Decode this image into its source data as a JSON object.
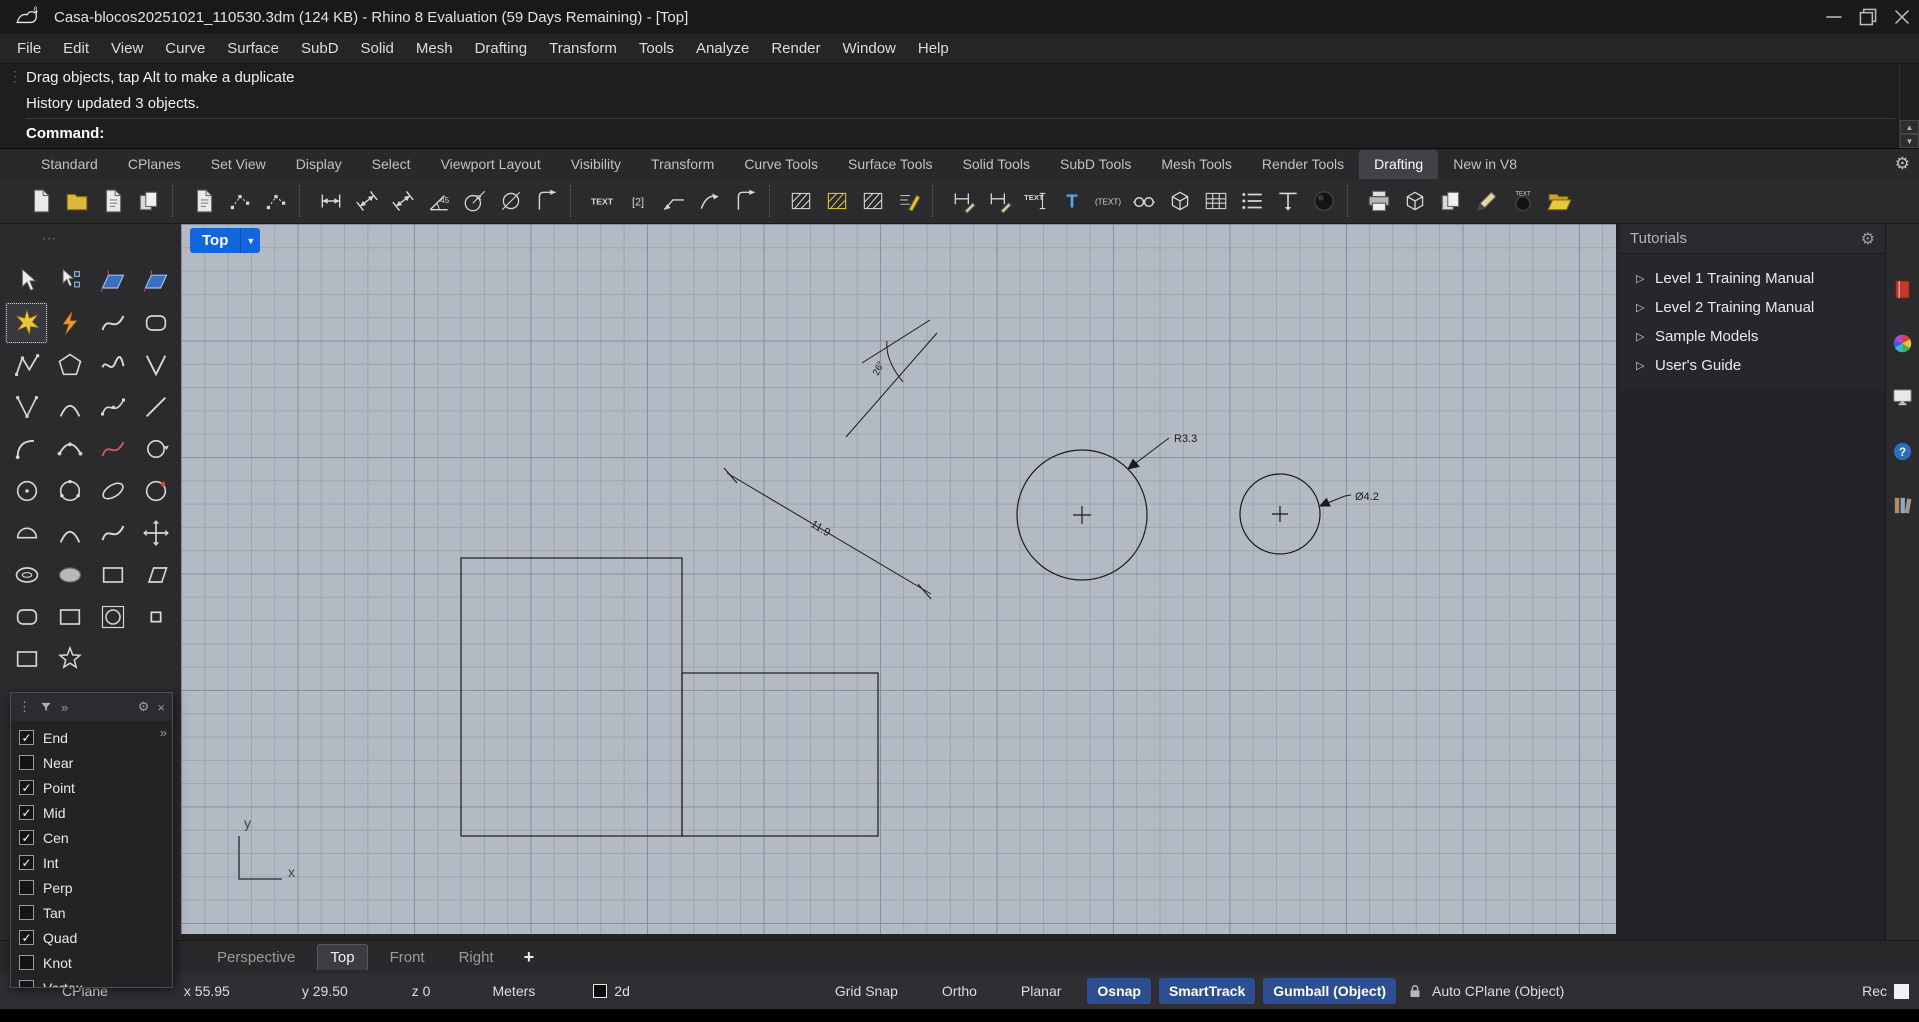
{
  "icons": {
    "gear_glyph": "⚙",
    "dropdown_glyph": "▼",
    "expander_glyph": "▷",
    "chevrons_glyph": "»",
    "close_glyph": "×",
    "dots_glyph": "⋮",
    "dots_h_glyph": "⋯",
    "plus_glyph": "+",
    "spin_up_glyph": "▲",
    "spin_down_glyph": "▼"
  },
  "colors": {
    "accent_blue": "#1266dd",
    "status_active_blue": "#2e4e92",
    "viewport_bg": "#b4bac3"
  },
  "title_bar": {
    "title": "Casa-blocos20251021_110530.3dm (124 KB) - Rhino 8 Evaluation (59 Days Remaining) - [Top]"
  },
  "menu": {
    "items": [
      "File",
      "Edit",
      "View",
      "Curve",
      "Surface",
      "SubD",
      "Solid",
      "Mesh",
      "Drafting",
      "Transform",
      "Tools",
      "Analyze",
      "Render",
      "Window",
      "Help"
    ]
  },
  "command": {
    "history": [
      "Drag objects, tap Alt to make a duplicate",
      "History updated 3 objects."
    ],
    "prompt_label": "Command:"
  },
  "toolbar_tabs": {
    "items": [
      {
        "label": "Standard"
      },
      {
        "label": "CPlanes"
      },
      {
        "label": "Set View"
      },
      {
        "label": "Display"
      },
      {
        "label": "Select"
      },
      {
        "label": "Viewport Layout"
      },
      {
        "label": "Visibility"
      },
      {
        "label": "Transform"
      },
      {
        "label": "Curve Tools"
      },
      {
        "label": "Surface Tools"
      },
      {
        "label": "Solid Tools"
      },
      {
        "label": "SubD Tools"
      },
      {
        "label": "Mesh Tools"
      },
      {
        "label": "Render Tools"
      },
      {
        "label": "Drafting",
        "active": true
      },
      {
        "label": "New in V8"
      }
    ]
  },
  "toolbar_icons": {
    "items": [
      {
        "name": "new-file-icon",
        "k": "page"
      },
      {
        "name": "open-file-icon",
        "k": "folder"
      },
      {
        "name": "save-file-icon",
        "k": "page-lines"
      },
      {
        "name": "copy-file-icon",
        "k": "pages"
      },
      {
        "sep": true
      },
      {
        "name": "notes-icon",
        "k": "page-lines"
      },
      {
        "name": "point-numbering-icon",
        "k": "points"
      },
      {
        "name": "point-line-icon",
        "k": "points"
      },
      {
        "sep": true
      },
      {
        "name": "dim-horizontal-icon",
        "k": "dim"
      },
      {
        "name": "dim-aligned-icon",
        "k": "dim-slant"
      },
      {
        "name": "dim-rotated-icon",
        "k": "dim-slant"
      },
      {
        "name": "dim-angle-icon",
        "k": "angle45"
      },
      {
        "name": "dim-radius-icon",
        "k": "radius"
      },
      {
        "name": "dim-diameter-icon",
        "k": "diameter"
      },
      {
        "name": "dim-ordinate-icon",
        "k": "ordinate"
      },
      {
        "sep": true
      },
      {
        "name": "text-block-icon",
        "k": "text",
        "label": "TEXT"
      },
      {
        "name": "annotation-count-icon",
        "k": "bracket",
        "label": "[2]"
      },
      {
        "name": "leader-icon",
        "k": "leader"
      },
      {
        "name": "curved-leader-icon",
        "k": "arrow-curve"
      },
      {
        "name": "ordinate-leader-icon",
        "k": "ordinate"
      },
      {
        "sep": true
      },
      {
        "name": "hatch-icon",
        "k": "hatch"
      },
      {
        "name": "hatch-pattern-icon",
        "k": "hatch",
        "color": "#d9c544"
      },
      {
        "name": "hatch-boundary-icon",
        "k": "hatch"
      },
      {
        "name": "match-annotation-icon",
        "k": "match",
        "color": "#d9c544"
      },
      {
        "sep": true
      },
      {
        "name": "edit-dimension-icon",
        "k": "dim-edit"
      },
      {
        "name": "dimension-recenter-icon",
        "k": "dim-edit"
      },
      {
        "name": "edit-text-icon",
        "k": "text-edit",
        "label": "TEXT"
      },
      {
        "name": "text-height-icon",
        "k": "tblue"
      },
      {
        "name": "find-text-icon",
        "k": "text-paren",
        "label": "(TEXT)"
      },
      {
        "name": "annotation-scale-icon",
        "k": "glasses"
      },
      {
        "name": "text-orientation-icon",
        "k": "cube"
      },
      {
        "name": "annotation-styles-icon",
        "k": "table"
      },
      {
        "name": "annotation-list-icon",
        "k": "list"
      },
      {
        "name": "isometric-text-icon",
        "k": "tpost"
      },
      {
        "name": "shaded-sphere-icon",
        "k": "sphere"
      },
      {
        "sep": true
      },
      {
        "name": "print-icon",
        "k": "printer"
      },
      {
        "name": "layout-box-icon",
        "k": "cube"
      },
      {
        "name": "copy-layout-icon",
        "k": "pages"
      },
      {
        "name": "annotate-pen-icon",
        "k": "pen"
      },
      {
        "name": "text-sphere-icon",
        "k": "sphere-text",
        "label": "TEXT"
      },
      {
        "name": "open-template-icon",
        "k": "folder-open"
      }
    ]
  },
  "tool_palette": {
    "items": [
      {
        "name": "select-tool",
        "k": "cursor"
      },
      {
        "name": "selection-filter-tool",
        "k": "cursor-pts"
      },
      {
        "name": "cplane-tool",
        "k": "cplane"
      },
      {
        "name": "cplane-rotate-tool",
        "k": "cplane"
      },
      {
        "name": "explode-tool",
        "k": "star",
        "color": "#e8c83a",
        "selected": true
      },
      {
        "name": "curve-boolean-tool",
        "k": "bolt",
        "color": "#e8963a"
      },
      {
        "name": "freeform-curve-tool",
        "k": "squiggle"
      },
      {
        "name": "rebuild-curve-tool",
        "k": "roundrect"
      },
      {
        "name": "polyline-tool",
        "k": "polyline"
      },
      {
        "name": "polygon-tool",
        "k": "polygon"
      },
      {
        "name": "sketch-curve-tool",
        "k": "squiggle2"
      },
      {
        "name": "kink-curve-tool",
        "k": "vee"
      },
      {
        "name": "curve-through-points-tool",
        "k": "vee-pts"
      },
      {
        "name": "arc-tool",
        "k": "arc"
      },
      {
        "name": "handle-curve-tool",
        "k": "curve-pts"
      },
      {
        "name": "line-tool",
        "k": "line"
      },
      {
        "name": "arc-center-tool",
        "k": "arc2"
      },
      {
        "name": "arc-3pt-tool",
        "k": "arc3"
      },
      {
        "name": "control-point-curve-tool",
        "k": "squiggle",
        "color": "#cc5555"
      },
      {
        "name": "circle-tangent-tool",
        "k": "rotate"
      },
      {
        "name": "circle-center-tool",
        "k": "circle-pt"
      },
      {
        "name": "circle-3pt-tool",
        "k": "circle-3"
      },
      {
        "name": "ellipse-diagonal-tool",
        "k": "ellipse-diag"
      },
      {
        "name": "circle-deformable-tool",
        "k": "circle-deco"
      },
      {
        "name": "semicircle-tool",
        "k": "semi"
      },
      {
        "name": "arc-blend-tool",
        "k": "arc"
      },
      {
        "name": "blend-curve-tool",
        "k": "squiggle"
      },
      {
        "name": "move-tool",
        "k": "move4"
      },
      {
        "name": "torus-tool",
        "k": "torus"
      },
      {
        "name": "ellipse-tool",
        "k": "ellipse-fill"
      },
      {
        "name": "rectangle-tool",
        "k": "rect"
      },
      {
        "name": "parallelogram-tool",
        "k": "para"
      },
      {
        "name": "rounded-rectangle-tool",
        "k": "roundrect"
      },
      {
        "name": "rectangle-3pt-tool",
        "k": "rect"
      },
      {
        "name": "circle-in-rectangle-tool",
        "k": "circle-sq"
      },
      {
        "name": "point-rectangle-tool",
        "k": "sq-small"
      },
      {
        "name": "square-tool",
        "k": "rect"
      },
      {
        "name": "star-tool",
        "k": "star-outline"
      }
    ]
  },
  "osnap": {
    "items": [
      {
        "label": "End",
        "checked": true
      },
      {
        "label": "Near",
        "checked": false
      },
      {
        "label": "Point",
        "checked": true
      },
      {
        "label": "Mid",
        "checked": true
      },
      {
        "label": "Cen",
        "checked": true
      },
      {
        "label": "Int",
        "checked": true
      },
      {
        "label": "Perp",
        "checked": false
      },
      {
        "label": "Tan",
        "checked": false
      },
      {
        "label": "Quad",
        "checked": true
      },
      {
        "label": "Knot",
        "checked": false
      },
      {
        "label": "Vertex",
        "checked": false
      }
    ]
  },
  "viewport": {
    "label": "Top",
    "axis_x": "x",
    "axis_y": "y",
    "dims": {
      "radius": "R3.3",
      "diameter": "Ø4.2",
      "length": "11.9",
      "angle": "26°"
    }
  },
  "viewport_tabs": {
    "items": [
      {
        "label": "Perspective"
      },
      {
        "label": "Top",
        "active": true
      },
      {
        "label": "Front"
      },
      {
        "label": "Right"
      }
    ]
  },
  "tutorials": {
    "title": "Tutorials",
    "items": [
      {
        "label": "Level 1 Training Manual"
      },
      {
        "label": "Level 2 Training Manual"
      },
      {
        "label": "Sample Models"
      },
      {
        "label": "User's Guide"
      }
    ]
  },
  "side_panels": {
    "items": [
      {
        "name": "tutorials-panel-icon",
        "k": "book"
      },
      {
        "name": "color-wheel-icon",
        "k": "wheel"
      },
      {
        "name": "display-panel-icon",
        "k": "monitor"
      },
      {
        "name": "help-panel-icon",
        "k": "helpbook"
      },
      {
        "name": "libraries-panel-icon",
        "k": "shelf"
      }
    ]
  },
  "status_bar": {
    "cplane": "CPlane",
    "coord_x": "x 55.95",
    "coord_y": "y 29.50",
    "coord_z": "z 0",
    "units": "Meters",
    "layer": "2d",
    "toggles": [
      {
        "label": "Grid Snap"
      },
      {
        "label": "Ortho"
      },
      {
        "label": "Planar"
      },
      {
        "label": "Osnap",
        "active": true
      },
      {
        "label": "SmartTrack",
        "active": true
      },
      {
        "label": "Gumball (Object)",
        "active": true
      }
    ],
    "auto_cplane": "Auto CPlane (Object)",
    "record": "Rec"
  }
}
